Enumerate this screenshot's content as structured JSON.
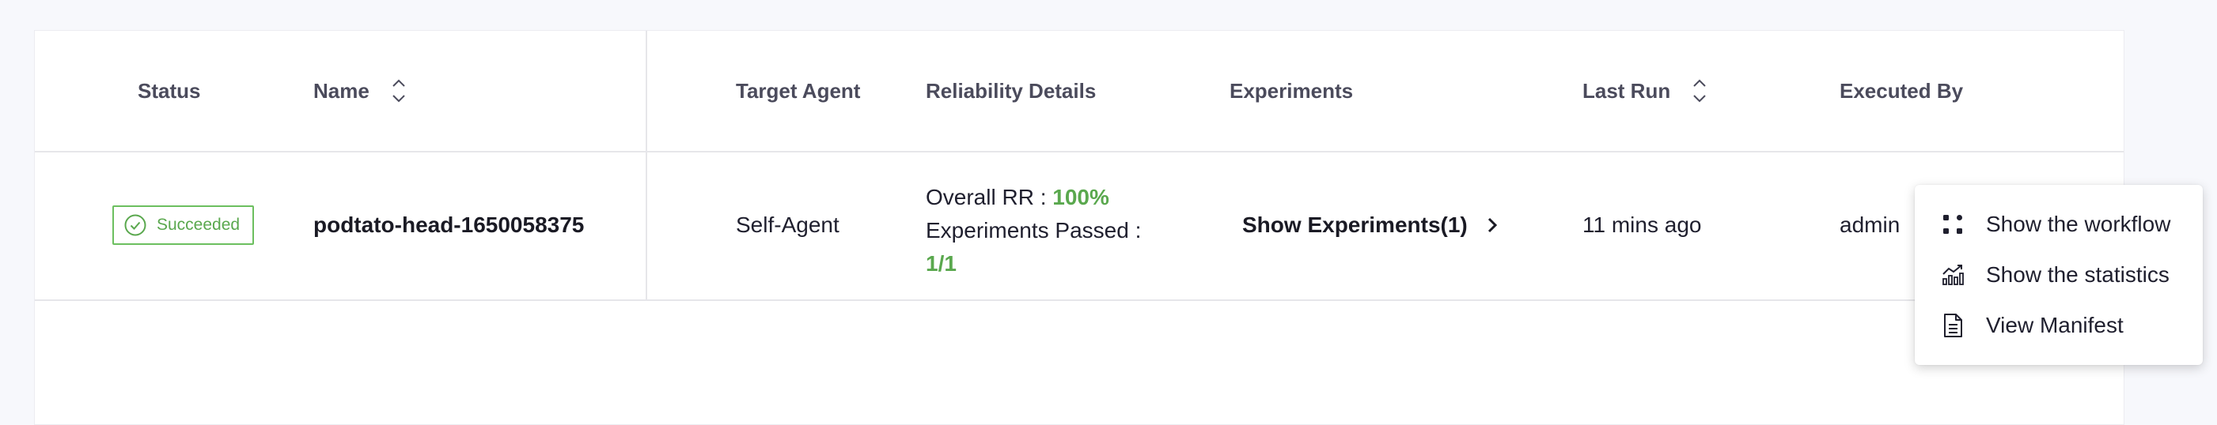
{
  "table": {
    "headers": {
      "status": "Status",
      "name": "Name",
      "target_agent": "Target Agent",
      "reliability_details": "Reliability Details",
      "experiments": "Experiments",
      "last_run": "Last Run",
      "executed_by": "Executed By"
    },
    "rows": [
      {
        "status": "Succeeded",
        "name": "podtato-head-1650058375",
        "target_agent": "Self-Agent",
        "overall_rr_label": "Overall RR : ",
        "overall_rr_value": "100%",
        "experiments_passed_label": "Experiments Passed :",
        "experiments_passed_value": "1/1",
        "experiments_button": "Show Experiments(1)",
        "last_run": "11 mins ago",
        "executed_by": "admin"
      }
    ]
  },
  "context_menu": {
    "items": [
      {
        "label": "Show the workflow",
        "icon": "workflow-icon"
      },
      {
        "label": "Show the statistics",
        "icon": "statistics-icon"
      },
      {
        "label": "View Manifest",
        "icon": "manifest-icon"
      }
    ]
  },
  "colors": {
    "success": "#5aa84e",
    "header_text": "#4b4b5c",
    "background": "#f7f8fc"
  }
}
